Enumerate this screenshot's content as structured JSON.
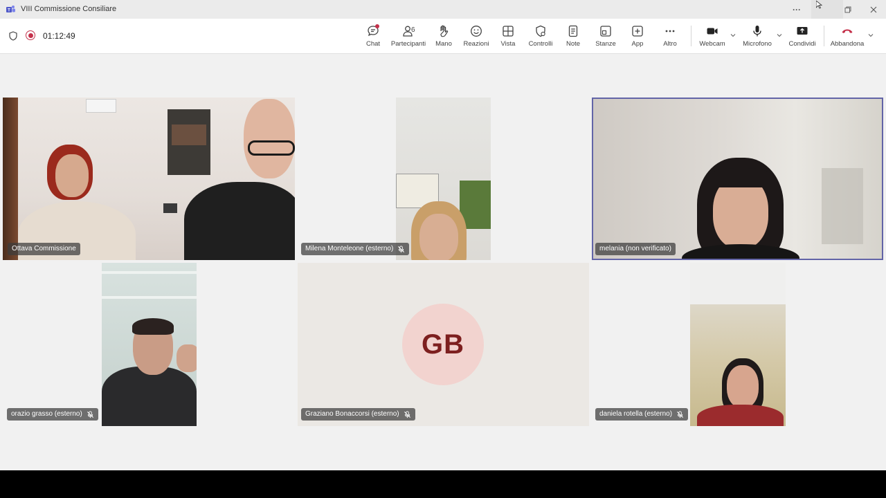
{
  "window": {
    "title": "VIII Commissione Consiliare",
    "more_label": "···"
  },
  "toolbar": {
    "timer": "01:12:49",
    "buttons": [
      {
        "label": "Chat"
      },
      {
        "label": "Partecipanti",
        "count": "6"
      },
      {
        "label": "Mano"
      },
      {
        "label": "Reazioni"
      },
      {
        "label": "Vista"
      },
      {
        "label": "Controlli"
      },
      {
        "label": "Note"
      },
      {
        "label": "Stanze"
      },
      {
        "label": "App"
      },
      {
        "label": "Altro"
      },
      {
        "label": "Webcam"
      },
      {
        "label": "Microfono"
      },
      {
        "label": "Condividi"
      },
      {
        "label": "Abbandona"
      }
    ]
  },
  "participants": [
    {
      "name": "Ottava Commissione",
      "muted": false
    },
    {
      "name": "Milena Monteleone (esterno)",
      "muted": true
    },
    {
      "name": "melania (non verificato)",
      "muted": false,
      "active_speaker": true
    },
    {
      "name": "orazio grasso (esterno)",
      "muted": true
    },
    {
      "name": "Graziano Bonaccorsi (esterno)",
      "muted": true,
      "initials": "GB"
    },
    {
      "name": "daniela rotella (esterno)",
      "muted": true
    }
  ],
  "colors": {
    "accent": "#6264a7",
    "leave": "#c4314b",
    "avatar_bg": "#f2d3cf",
    "avatar_text": "#7d1f1f"
  }
}
